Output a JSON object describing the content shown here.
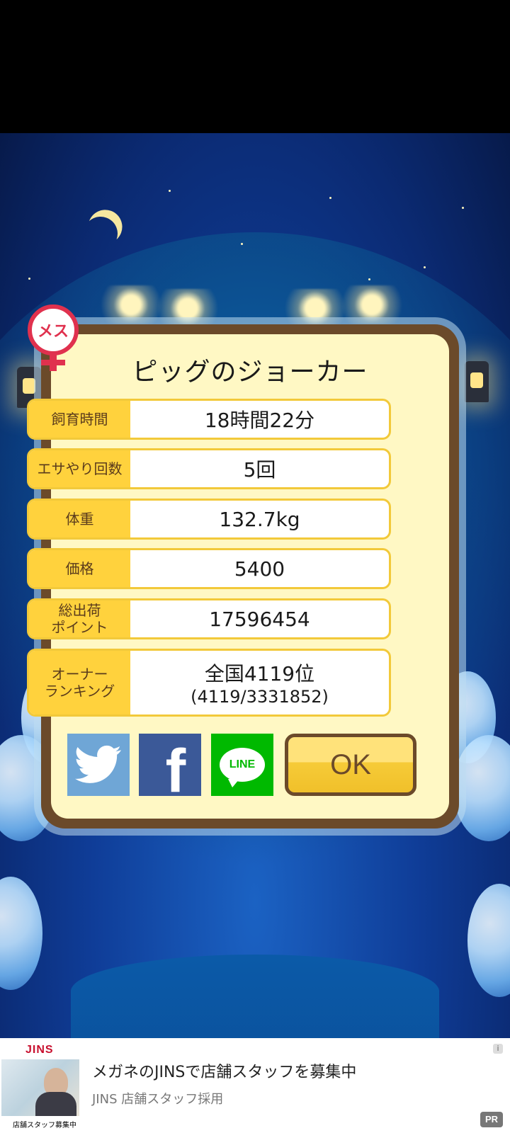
{
  "dialog": {
    "title": "ピッグのジョーカー",
    "gender_badge": "メス",
    "stats": [
      {
        "label": "飼育時間",
        "value": "18時間22分"
      },
      {
        "label": "エサやり回数",
        "value": "5回"
      },
      {
        "label": "体重",
        "value": "132.7kg"
      },
      {
        "label": "価格",
        "value": "5400"
      },
      {
        "label": "総出荷\nポイント",
        "value": "17596454"
      },
      {
        "label": "オーナー\nランキング",
        "value": "全国4119位",
        "sub_value": "(4119/3331852)"
      }
    ],
    "share_icons": [
      "twitter-icon",
      "facebook-icon",
      "line-icon"
    ],
    "line_text": "LINE",
    "ok_label": "OK"
  },
  "ad": {
    "brand": "JINS",
    "image_caption": "店舗スタッフ募集中",
    "title": "メガネのJINSで店舗スタッフを募集中",
    "subtitle": "JINS 店舗スタッフ採用",
    "badge": "PR",
    "info_icon": "i"
  },
  "colors": {
    "label_bg": "#ffd23d",
    "dialog_border": "#6b4a2a",
    "dialog_bg": "#fff8c4",
    "twitter": "#6fa6d6",
    "facebook": "#3b5998",
    "line": "#00b900"
  }
}
